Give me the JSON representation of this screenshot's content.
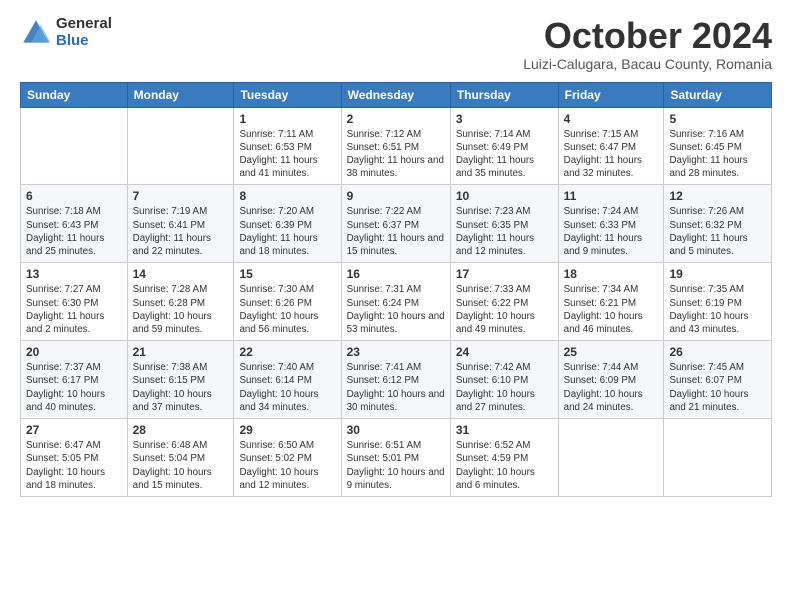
{
  "logo": {
    "general": "General",
    "blue": "Blue"
  },
  "header": {
    "month": "October 2024",
    "location": "Luizi-Calugara, Bacau County, Romania"
  },
  "weekdays": [
    "Sunday",
    "Monday",
    "Tuesday",
    "Wednesday",
    "Thursday",
    "Friday",
    "Saturday"
  ],
  "weeks": [
    [
      {
        "day": "",
        "info": ""
      },
      {
        "day": "",
        "info": ""
      },
      {
        "day": "1",
        "info": "Sunrise: 7:11 AM\nSunset: 6:53 PM\nDaylight: 11 hours and 41 minutes."
      },
      {
        "day": "2",
        "info": "Sunrise: 7:12 AM\nSunset: 6:51 PM\nDaylight: 11 hours and 38 minutes."
      },
      {
        "day": "3",
        "info": "Sunrise: 7:14 AM\nSunset: 6:49 PM\nDaylight: 11 hours and 35 minutes."
      },
      {
        "day": "4",
        "info": "Sunrise: 7:15 AM\nSunset: 6:47 PM\nDaylight: 11 hours and 32 minutes."
      },
      {
        "day": "5",
        "info": "Sunrise: 7:16 AM\nSunset: 6:45 PM\nDaylight: 11 hours and 28 minutes."
      }
    ],
    [
      {
        "day": "6",
        "info": "Sunrise: 7:18 AM\nSunset: 6:43 PM\nDaylight: 11 hours and 25 minutes."
      },
      {
        "day": "7",
        "info": "Sunrise: 7:19 AM\nSunset: 6:41 PM\nDaylight: 11 hours and 22 minutes."
      },
      {
        "day": "8",
        "info": "Sunrise: 7:20 AM\nSunset: 6:39 PM\nDaylight: 11 hours and 18 minutes."
      },
      {
        "day": "9",
        "info": "Sunrise: 7:22 AM\nSunset: 6:37 PM\nDaylight: 11 hours and 15 minutes."
      },
      {
        "day": "10",
        "info": "Sunrise: 7:23 AM\nSunset: 6:35 PM\nDaylight: 11 hours and 12 minutes."
      },
      {
        "day": "11",
        "info": "Sunrise: 7:24 AM\nSunset: 6:33 PM\nDaylight: 11 hours and 9 minutes."
      },
      {
        "day": "12",
        "info": "Sunrise: 7:26 AM\nSunset: 6:32 PM\nDaylight: 11 hours and 5 minutes."
      }
    ],
    [
      {
        "day": "13",
        "info": "Sunrise: 7:27 AM\nSunset: 6:30 PM\nDaylight: 11 hours and 2 minutes."
      },
      {
        "day": "14",
        "info": "Sunrise: 7:28 AM\nSunset: 6:28 PM\nDaylight: 10 hours and 59 minutes."
      },
      {
        "day": "15",
        "info": "Sunrise: 7:30 AM\nSunset: 6:26 PM\nDaylight: 10 hours and 56 minutes."
      },
      {
        "day": "16",
        "info": "Sunrise: 7:31 AM\nSunset: 6:24 PM\nDaylight: 10 hours and 53 minutes."
      },
      {
        "day": "17",
        "info": "Sunrise: 7:33 AM\nSunset: 6:22 PM\nDaylight: 10 hours and 49 minutes."
      },
      {
        "day": "18",
        "info": "Sunrise: 7:34 AM\nSunset: 6:21 PM\nDaylight: 10 hours and 46 minutes."
      },
      {
        "day": "19",
        "info": "Sunrise: 7:35 AM\nSunset: 6:19 PM\nDaylight: 10 hours and 43 minutes."
      }
    ],
    [
      {
        "day": "20",
        "info": "Sunrise: 7:37 AM\nSunset: 6:17 PM\nDaylight: 10 hours and 40 minutes."
      },
      {
        "day": "21",
        "info": "Sunrise: 7:38 AM\nSunset: 6:15 PM\nDaylight: 10 hours and 37 minutes."
      },
      {
        "day": "22",
        "info": "Sunrise: 7:40 AM\nSunset: 6:14 PM\nDaylight: 10 hours and 34 minutes."
      },
      {
        "day": "23",
        "info": "Sunrise: 7:41 AM\nSunset: 6:12 PM\nDaylight: 10 hours and 30 minutes."
      },
      {
        "day": "24",
        "info": "Sunrise: 7:42 AM\nSunset: 6:10 PM\nDaylight: 10 hours and 27 minutes."
      },
      {
        "day": "25",
        "info": "Sunrise: 7:44 AM\nSunset: 6:09 PM\nDaylight: 10 hours and 24 minutes."
      },
      {
        "day": "26",
        "info": "Sunrise: 7:45 AM\nSunset: 6:07 PM\nDaylight: 10 hours and 21 minutes."
      }
    ],
    [
      {
        "day": "27",
        "info": "Sunrise: 6:47 AM\nSunset: 5:05 PM\nDaylight: 10 hours and 18 minutes."
      },
      {
        "day": "28",
        "info": "Sunrise: 6:48 AM\nSunset: 5:04 PM\nDaylight: 10 hours and 15 minutes."
      },
      {
        "day": "29",
        "info": "Sunrise: 6:50 AM\nSunset: 5:02 PM\nDaylight: 10 hours and 12 minutes."
      },
      {
        "day": "30",
        "info": "Sunrise: 6:51 AM\nSunset: 5:01 PM\nDaylight: 10 hours and 9 minutes."
      },
      {
        "day": "31",
        "info": "Sunrise: 6:52 AM\nSunset: 4:59 PM\nDaylight: 10 hours and 6 minutes."
      },
      {
        "day": "",
        "info": ""
      },
      {
        "day": "",
        "info": ""
      }
    ]
  ]
}
